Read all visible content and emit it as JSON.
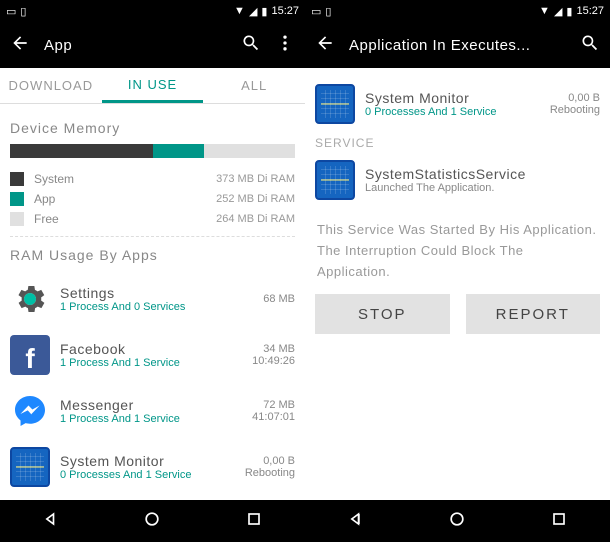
{
  "status": {
    "time": "15:27"
  },
  "left": {
    "title": "App",
    "tabs": {
      "download": "DOWNLOAD",
      "inuse": "IN USE",
      "all": "ALL"
    },
    "memory": {
      "section_title": "Device Memory",
      "system": {
        "label": "System",
        "value": "373 MB Di RAM",
        "pct": 50,
        "color": "#3a3a3a"
      },
      "app": {
        "label": "App",
        "value": "252 MB Di RAM",
        "pct": 18,
        "color": "#009688"
      },
      "free": {
        "label": "Free",
        "value": "264 MB Di RAM",
        "pct": 32,
        "color": "#e0e0e0"
      }
    },
    "ram_section": "RAM Usage By Apps",
    "apps": [
      {
        "icon": "gear",
        "name": "Settings",
        "sub": "1 Process And 0 Services",
        "v1": "68 MB",
        "v2": ""
      },
      {
        "icon": "fb",
        "name": "Facebook",
        "sub": "1 Process And 1 Service",
        "v1": "34 MB",
        "v2": "10:49:26"
      },
      {
        "icon": "msgr",
        "name": "Messenger",
        "sub": "1 Process And 1 Service",
        "v1": "72 MB",
        "v2": "41:07:01"
      },
      {
        "icon": "sysmon",
        "name": "System Monitor",
        "sub": "0 Processes And 1 Service",
        "v1": "0,00 B",
        "v2": "Rebooting"
      }
    ]
  },
  "right": {
    "title": "Application In Executes...",
    "app": {
      "name": "System Monitor",
      "sub": "0 Processes And 1 Service",
      "v1": "0,00 B",
      "v2": "Rebooting"
    },
    "service_label": "SERVICE",
    "service": {
      "name": "SystemStatisticsService",
      "sub": "Launched The Application."
    },
    "desc": "This Service Was Started By His Application. The Interruption Could Block The Application.",
    "stop": "STOP",
    "report": "REPORT"
  }
}
